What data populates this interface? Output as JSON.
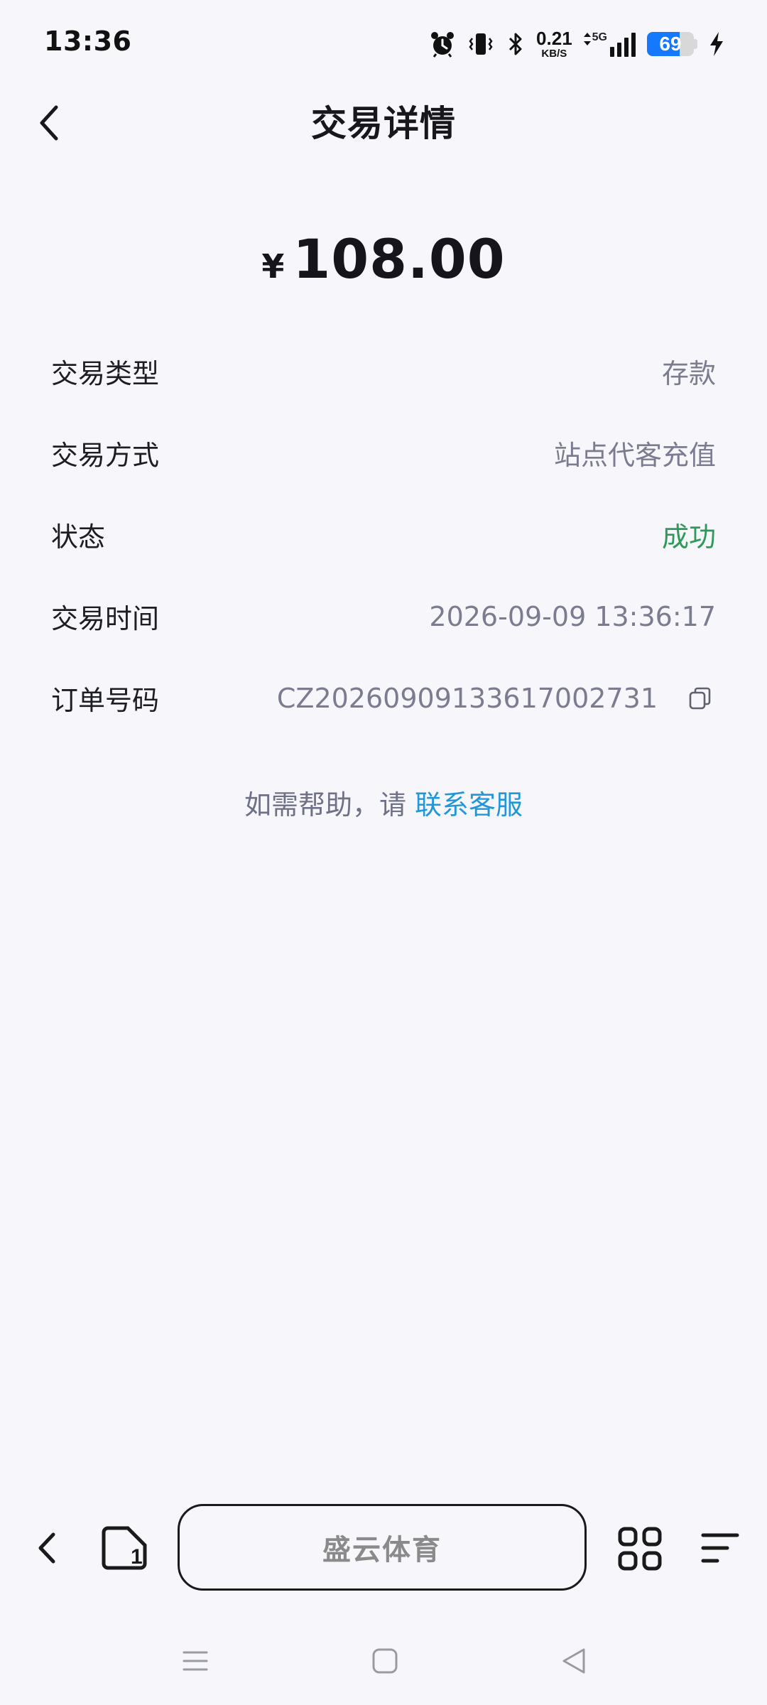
{
  "status_bar": {
    "time": "13:36",
    "net_speed_value": "0.21",
    "net_speed_unit": "KB/S",
    "network_type": "5G",
    "battery_level": "69",
    "icons": [
      "alarm-icon",
      "vibrate-icon",
      "bluetooth-icon",
      "data-arrows-icon",
      "signal-icon",
      "battery-icon",
      "charging-icon"
    ]
  },
  "header": {
    "title": "交易详情",
    "back_icon": "chevron-left-icon"
  },
  "amount": {
    "currency": "¥",
    "value": "108.00"
  },
  "details": [
    {
      "label": "交易类型",
      "value": "存款"
    },
    {
      "label": "交易方式",
      "value": "站点代客充值"
    },
    {
      "label": "状态",
      "value": "成功"
    },
    {
      "label": "交易时间",
      "value": "2026-09-09 13:36:17"
    },
    {
      "label": "订单号码",
      "value": "CZ20260909133617002731"
    }
  ],
  "help": {
    "prefix": "如需帮助，请 ",
    "link": "联系客服"
  },
  "browser_bar": {
    "address_label": "盛云体育",
    "tabs_count": "1"
  },
  "colors": {
    "background": "#f7f7fb",
    "success": "#2e9a57",
    "link": "#2196d9",
    "value_gray": "#7b7c8f",
    "battery_blue": "#1677ff"
  }
}
